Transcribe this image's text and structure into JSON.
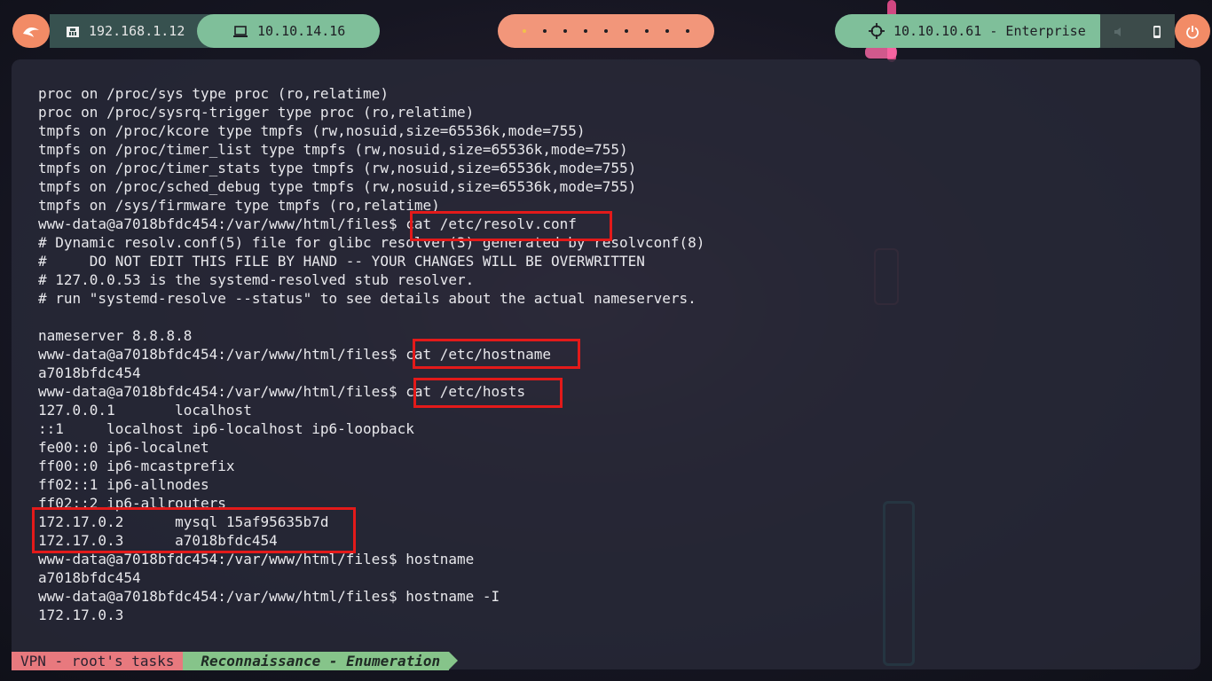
{
  "topbar": {
    "host_ip": "192.168.1.12",
    "vpn_ip": "10.10.14.16",
    "target": "10.10.10.61 - Enterprise",
    "workspace_dots": 9,
    "active_workspace": 1
  },
  "terminal": {
    "lines": [
      "proc on /proc/sys type proc (ro,relatime)",
      "proc on /proc/sysrq-trigger type proc (ro,relatime)",
      "tmpfs on /proc/kcore type tmpfs (rw,nosuid,size=65536k,mode=755)",
      "tmpfs on /proc/timer_list type tmpfs (rw,nosuid,size=65536k,mode=755)",
      "tmpfs on /proc/timer_stats type tmpfs (rw,nosuid,size=65536k,mode=755)",
      "tmpfs on /proc/sched_debug type tmpfs (rw,nosuid,size=65536k,mode=755)",
      "tmpfs on /sys/firmware type tmpfs (ro,relatime)",
      "www-data@a7018bfdc454:/var/www/html/files$ cat /etc/resolv.conf",
      "# Dynamic resolv.conf(5) file for glibc resolver(3) generated by resolvconf(8)",
      "#     DO NOT EDIT THIS FILE BY HAND -- YOUR CHANGES WILL BE OVERWRITTEN",
      "# 127.0.0.53 is the systemd-resolved stub resolver.",
      "# run \"systemd-resolve --status\" to see details about the actual nameservers.",
      "",
      "nameserver 8.8.8.8",
      "www-data@a7018bfdc454:/var/www/html/files$ cat /etc/hostname",
      "a7018bfdc454",
      "www-data@a7018bfdc454:/var/www/html/files$ cat /etc/hosts",
      "127.0.0.1       localhost",
      "::1     localhost ip6-localhost ip6-loopback",
      "fe00::0 ip6-localnet",
      "ff00::0 ip6-mcastprefix",
      "ff02::1 ip6-allnodes",
      "ff02::2 ip6-allrouters",
      "172.17.0.2      mysql 15af95635b7d",
      "172.17.0.3      a7018bfdc454",
      "www-data@a7018bfdc454:/var/www/html/files$ hostname",
      "a7018bfdc454",
      "www-data@a7018bfdc454:/var/www/html/files$ hostname -I",
      "172.17.0.3"
    ]
  },
  "statusbar": {
    "session": "VPN - root's tasks",
    "window": "Reconnaissance - Enumeration"
  },
  "colors": {
    "highlight_box": "#e31a1a",
    "orange_pill": "#f28b66",
    "green_pill": "#7fbf9a"
  },
  "icons": [
    "kali-dragon-icon",
    "ethernet-icon",
    "laptop-icon",
    "crosshair-icon",
    "volume-icon",
    "phone-icon",
    "power-icon"
  ]
}
